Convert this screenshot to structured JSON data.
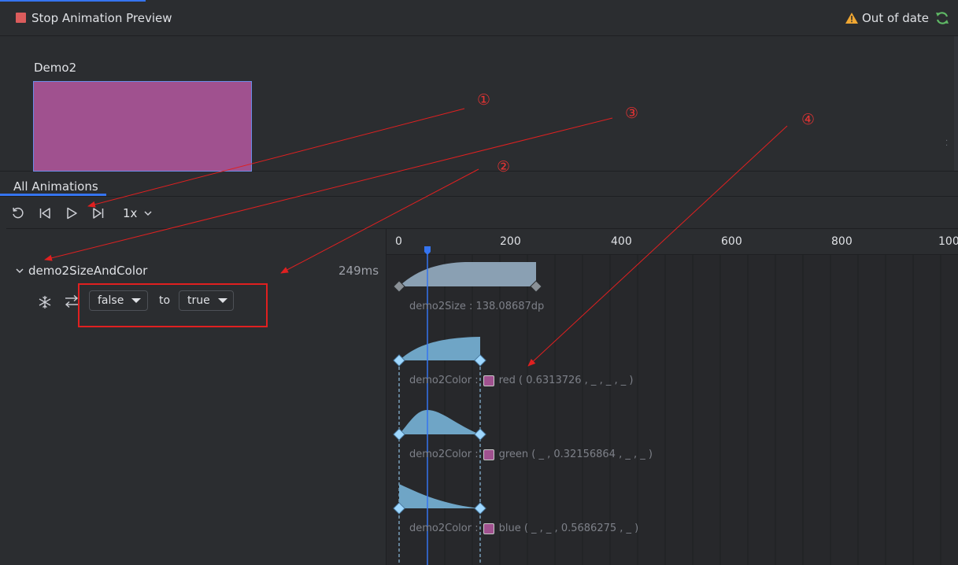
{
  "header": {
    "stop_label": "Stop Animation Preview",
    "status_label": "Out of date",
    "stop_icon": "stop-square-icon",
    "warning_icon": "warning-triangle-icon",
    "refresh_icon": "refresh-icon"
  },
  "preview": {
    "title": "Demo2",
    "box_color": "#a0518f"
  },
  "tabs": [
    {
      "label": "All Animations",
      "selected": true
    }
  ],
  "toolbar": {
    "icons": [
      "reset-icon",
      "skip-to-start-icon",
      "play-icon",
      "skip-to-end-icon"
    ],
    "speed": "1x"
  },
  "timeline": {
    "ticks": [
      "0",
      "200",
      "400",
      "600",
      "800",
      "100"
    ],
    "playhead_ms": 50
  },
  "animation": {
    "name": "demo2SizeAndColor",
    "duration": "249ms",
    "from_state": "false",
    "to_label": "to",
    "to_state": "true",
    "icons": [
      "freeze-icon",
      "swap-icon"
    ]
  },
  "properties": [
    {
      "name": "demo2Size :",
      "value": "138.08687dp",
      "has_swatch": false
    },
    {
      "name": "demo2Color :",
      "value": "red ( 0.6313726 , _ , _ , _ )",
      "has_swatch": true
    },
    {
      "name": "demo2Color :",
      "value": "green ( _ , 0.32156864 , _ , _ )",
      "has_swatch": true
    },
    {
      "name": "demo2Color :",
      "value": "blue ( _ , _ , 0.5686275 , _ )",
      "has_swatch": true
    }
  ],
  "annotations": {
    "markers": [
      "①",
      "②",
      "③",
      "④"
    ]
  },
  "colors": {
    "accent": "#3574f0",
    "annotation": "#e02020",
    "curve_fill": "#6fa5c6",
    "keyframe": "#9fd8ff",
    "swatch": "#a0518f"
  }
}
